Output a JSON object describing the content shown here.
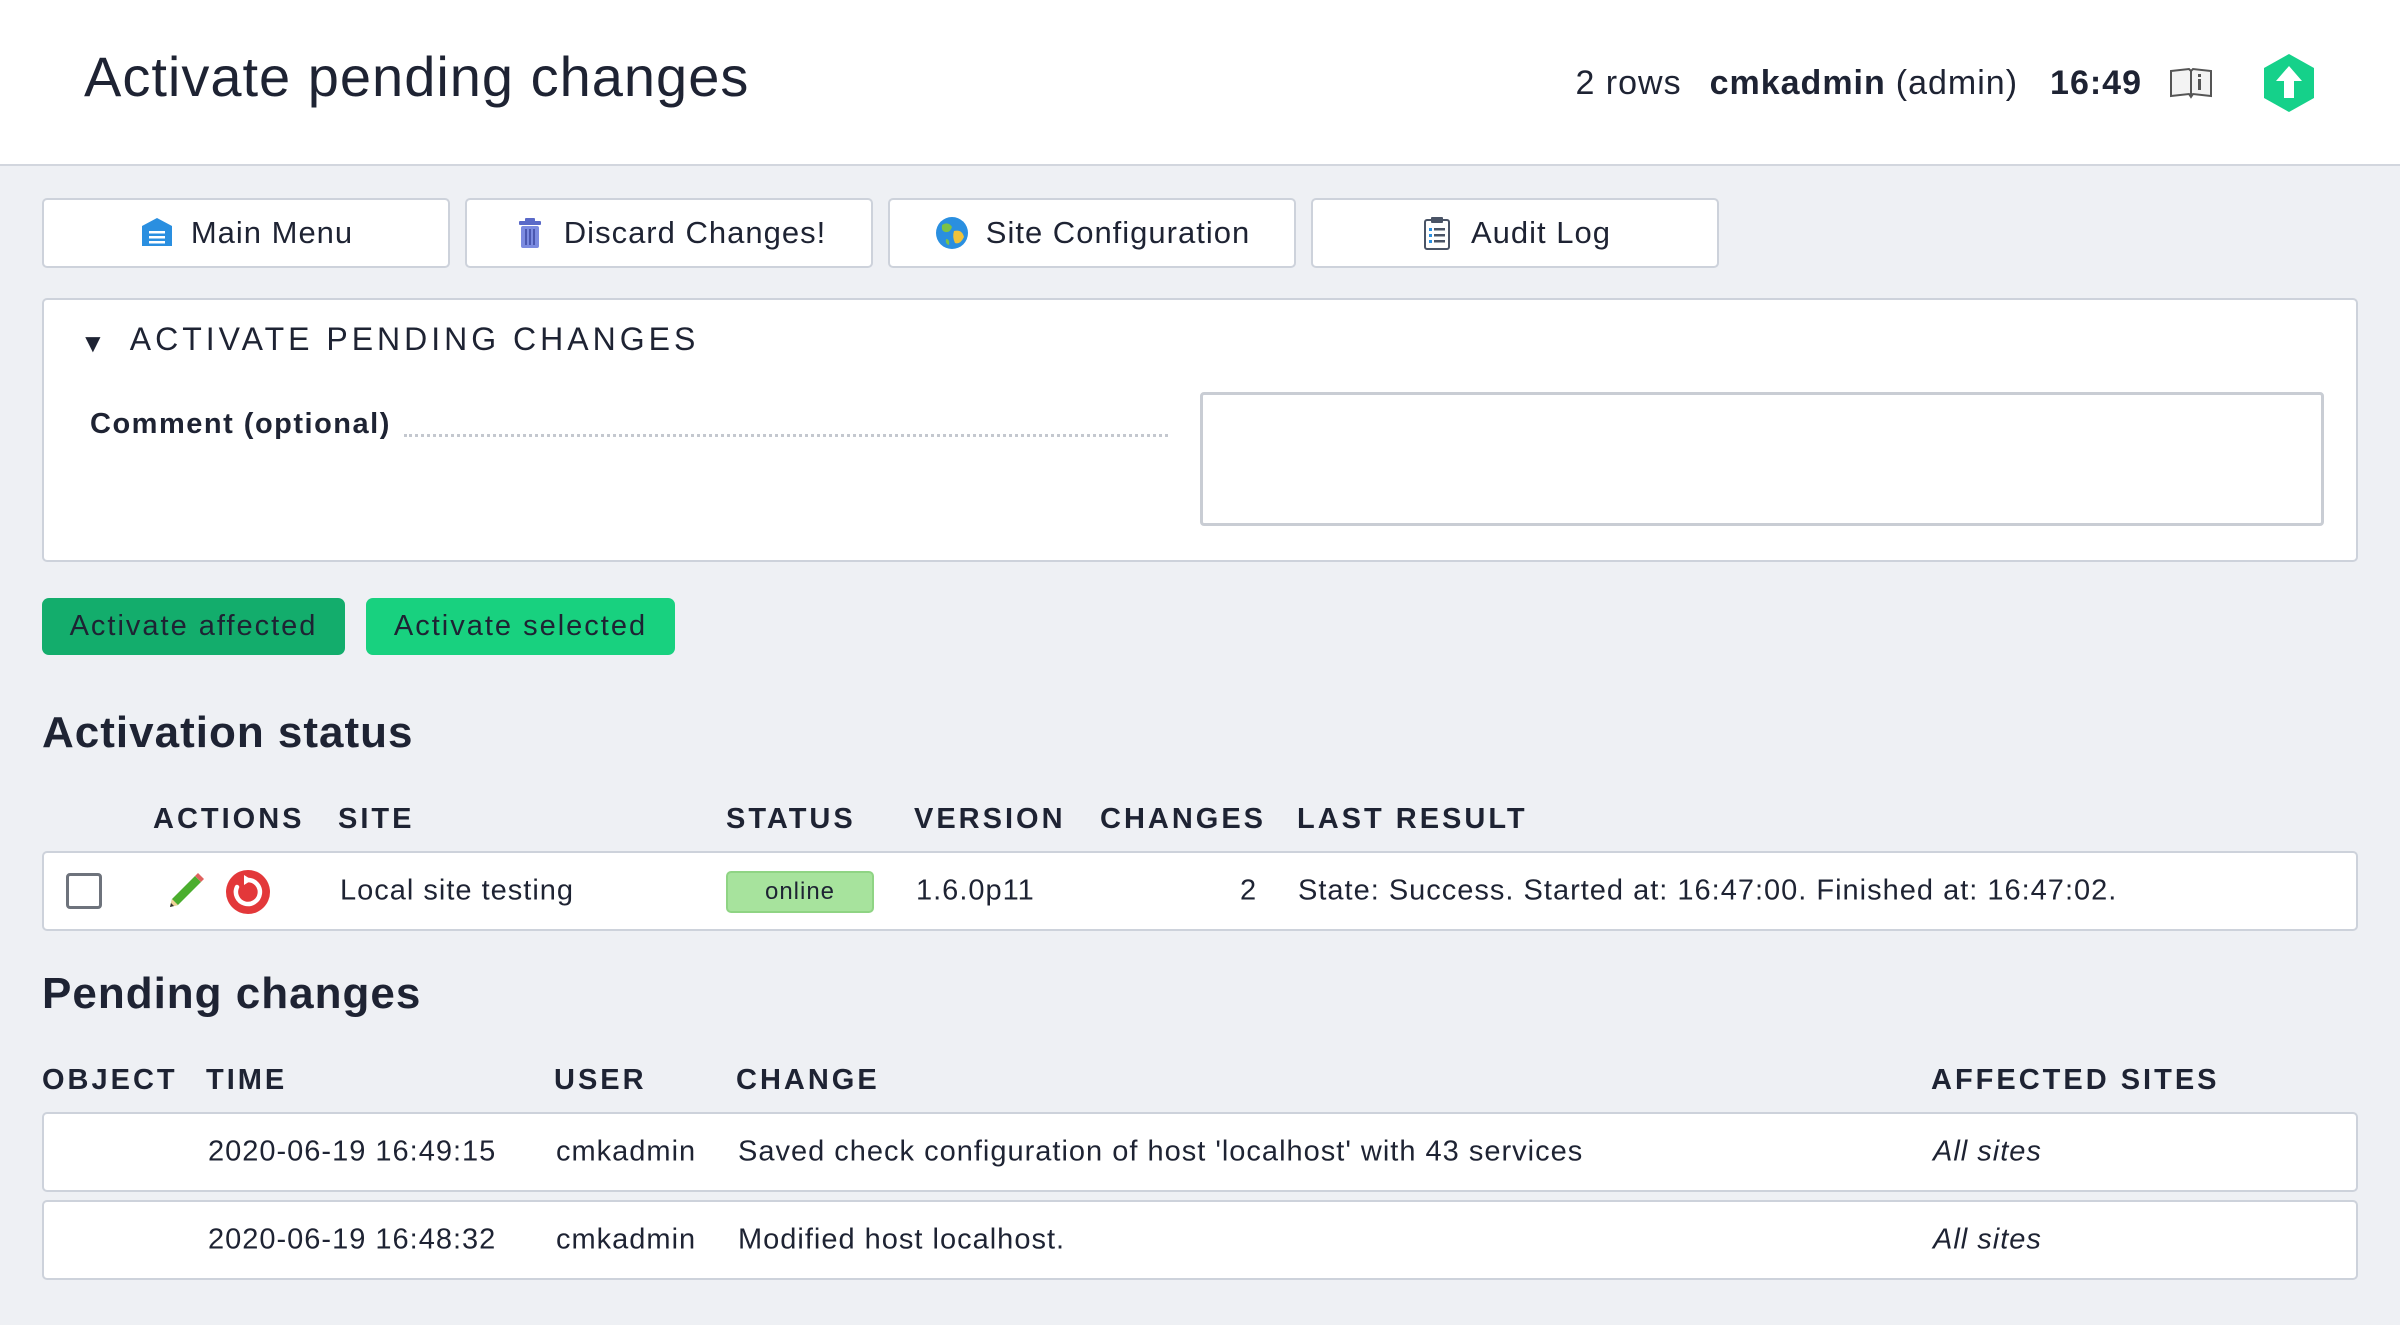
{
  "header": {
    "title": "Activate pending changes",
    "rows": "2 rows",
    "user": "cmkadmin",
    "role": "(admin)",
    "clock": "16:49",
    "icons": {
      "help": "book-info-icon",
      "logo": "checkmk-logo-icon"
    }
  },
  "tabs": [
    {
      "label": "Main Menu",
      "icon": "main-menu-icon"
    },
    {
      "label": "Discard Changes!",
      "icon": "trash-icon"
    },
    {
      "label": "Site Configuration",
      "icon": "globe-icon"
    },
    {
      "label": "Audit Log",
      "icon": "clipboard-icon"
    }
  ],
  "activate_panel": {
    "title": "ACTIVATE PENDING CHANGES",
    "comment_label": "Comment (optional)",
    "comment_value": ""
  },
  "buttons": {
    "activate_affected": "Activate affected",
    "activate_selected": "Activate selected"
  },
  "activation_status": {
    "title": "Activation status",
    "columns": [
      "ACTIONS",
      "SITE",
      "STATUS",
      "VERSION",
      "CHANGES",
      "LAST RESULT"
    ],
    "rows": [
      {
        "site": "Local site testing",
        "status": "online",
        "version": "1.6.0p11",
        "changes": "2",
        "last_result": "State: Success. Started at: 16:47:00. Finished at: 16:47:02."
      }
    ]
  },
  "pending_changes": {
    "title": "Pending changes",
    "columns": [
      "OBJECT",
      "TIME",
      "USER",
      "CHANGE",
      "AFFECTED SITES"
    ],
    "rows": [
      {
        "object": "",
        "time": "2020-06-19 16:49:15",
        "user": "cmkadmin",
        "change": "Saved check configuration of host 'localhost' with 43 services",
        "affected": "All sites"
      },
      {
        "object": "",
        "time": "2020-06-19 16:48:32",
        "user": "cmkadmin",
        "change": "Modified host localhost.",
        "affected": "All sites"
      }
    ]
  },
  "colors": {
    "accent_green": "#18d17f",
    "accent_green_dark": "#13ad6c",
    "status_online": "#a7e39d",
    "page_bg": "#eef0f4"
  }
}
